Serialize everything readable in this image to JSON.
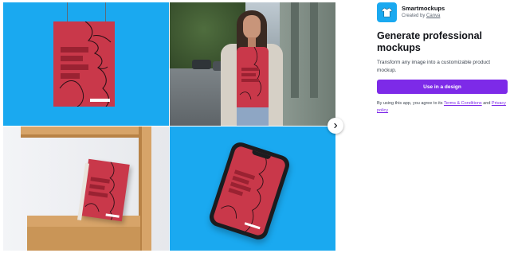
{
  "app": {
    "name": "Smartmockups",
    "creator_prefix": "Created by ",
    "creator_name": "Canva",
    "icon": "tshirt-icon",
    "icon_bg": "#1aa9f0"
  },
  "headline": "Generate professional mockups",
  "description": "Transform any image into a customizable product mockup.",
  "cta_label": "Use in a design",
  "legal": {
    "prefix": "By using this app, you agree to its ",
    "terms_link": "Terms & Conditions",
    "middle": " and ",
    "privacy_link": "Privacy policy"
  },
  "gallery": {
    "next_icon": "chevron-right-icon",
    "tiles": [
      "poster-mockup",
      "tshirt-mockup",
      "book-mockup",
      "phone-mockup"
    ]
  },
  "colors": {
    "accent": "#7d2ae8",
    "tile_blue": "#1aa9f0",
    "artwork_red": "#c9384a"
  }
}
